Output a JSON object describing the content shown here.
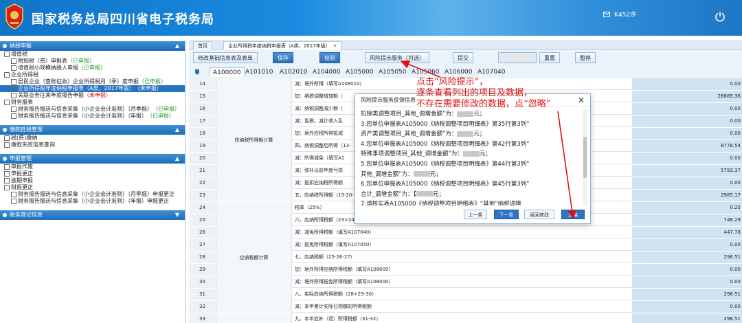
{
  "header": {
    "title": "国家税务总局四川省电子税务局",
    "user": "K452序"
  },
  "sidebar": {
    "sections": [
      {
        "title": "纳税申报",
        "items": [
          {
            "level": 1,
            "label": "增值税",
            "status": ""
          },
          {
            "level": 2,
            "label": "附加税（费）申报表",
            "status": "（已申报）",
            "status_color": "green"
          },
          {
            "level": 2,
            "label": "增值税小规模纳税人申报",
            "status": "（已申报）",
            "status_color": "green"
          },
          {
            "level": 1,
            "label": "企业所得税",
            "status": ""
          },
          {
            "level": 2,
            "label": "居民企业（查账征收）企业所得税月（季）度申报",
            "status": "（已申报）",
            "status_color": "green"
          },
          {
            "level": 2,
            "label": "企业所得税年度纳税申报表（A类，2017年版）",
            "status": "（未申报）",
            "status_color": "red",
            "selected": true
          },
          {
            "level": 2,
            "label": "关联业务往来年度报告申报",
            "status": "（未申报）",
            "status_color": "red"
          },
          {
            "level": 1,
            "label": "财务报表",
            "status": ""
          },
          {
            "level": 2,
            "label": "财务报告报送与信息采集（小企业会计准则）（月季报）",
            "status": "（已申报）",
            "status_color": "green"
          },
          {
            "level": 2,
            "label": "财务报告报送与信息采集（小企业会计准则）（年报）",
            "status": "（已申报）",
            "status_color": "green"
          }
        ]
      },
      {
        "title": "缴款抵税管理",
        "items": [
          {
            "level": 1,
            "label": "税(费)缴纳",
            "status": ""
          },
          {
            "level": 1,
            "label": "缴款失败信息查询",
            "status": ""
          }
        ]
      },
      {
        "title": "申报管理",
        "items": [
          {
            "level": 1,
            "label": "申报作废",
            "status": ""
          },
          {
            "level": 1,
            "label": "申报更正",
            "status": ""
          },
          {
            "level": 1,
            "label": "逾期申报",
            "status": ""
          },
          {
            "level": 1,
            "label": "财报更正",
            "status": ""
          },
          {
            "level": 2,
            "label": "财务报告报送与信息采集（小企业会计准则）（月季报）申报更正",
            "status": ""
          },
          {
            "level": 2,
            "label": "财务报告报送与信息采集（小企业会计准则）（年报）申报更正",
            "status": ""
          }
        ]
      },
      {
        "title": "税务登记信息",
        "items": []
      }
    ]
  },
  "tabs": [
    {
      "label": "首页",
      "closable": false
    },
    {
      "label": "企业所得税年度纳税申报表（A类，2017年版）",
      "closable": true
    }
  ],
  "toolbar": {
    "buttons": [
      "修改基础信息表及表单",
      "保存",
      "校验",
      "风险提示服务（可选）",
      "提交",
      "",
      "重置",
      "暂停"
    ]
  },
  "form_tabs": [
    "A100000",
    "A101010",
    "A102010",
    "A104000",
    "A105000",
    "A105050",
    "A105060",
    "A106000",
    "A107040"
  ],
  "grid": {
    "rows": [
      {
        "idx": "14",
        "desc": "减：境外所得（填写A108010）",
        "val": "0.00"
      },
      {
        "idx": "15",
        "desc": "加：纳税调整增加额（",
        "val": "26889.36"
      },
      {
        "idx": "16",
        "desc": "减：纳税调整减少额（",
        "val": "0.00"
      },
      {
        "idx": "17",
        "desc": "减：免税、减计收入及",
        "val": "0.00"
      },
      {
        "idx": "18",
        "desc": "加：境外应税所得抵减",
        "val": "0.00"
      },
      {
        "idx": "19",
        "desc": "四、纳税调整后所得（13-",
        "val": "8778.54"
      },
      {
        "idx": "20",
        "desc": "减：所得减免（填写A1",
        "val": "0.00"
      },
      {
        "idx": "21",
        "desc": "减：弥补以前年度亏损",
        "val": "5793.37"
      },
      {
        "idx": "22",
        "desc": "减：抵扣应纳税所得额",
        "val": "0.00"
      },
      {
        "idx": "23",
        "desc": "五、应纳税所得额（19-20-",
        "val": "2985.17"
      },
      {
        "idx": "24",
        "desc": "税率（25%）",
        "val": "0.25"
      },
      {
        "idx": "25",
        "desc": "六、应纳所得税额（23×24",
        "val": "746.29"
      },
      {
        "idx": "26",
        "desc": "减：减免所得税额（填写A107040）",
        "val": "447.78"
      },
      {
        "idx": "27",
        "desc": "减：抵免所得税额（填写A107050）",
        "val": "0.00"
      },
      {
        "idx": "28",
        "desc": "七、应纳税额（25-26-27）",
        "val": "298.51"
      },
      {
        "idx": "29",
        "desc": "加：境外所得应纳所得税额（填写A108000）",
        "val": "0.00"
      },
      {
        "idx": "30",
        "desc": "减：境外所得抵免所得税额（填写A108000）",
        "val": "0.00"
      },
      {
        "idx": "31",
        "desc": "八、实际应纳所得税额（28+29-30）",
        "val": "298.51"
      },
      {
        "idx": "32",
        "desc": "减：本年累计实际已预缴的所得税额",
        "val": "0.00"
      },
      {
        "idx": "33",
        "desc": "九、本年应补（退）所得税额（31-32）",
        "val": "298.51"
      }
    ],
    "category_1": "应纳税所得额计算",
    "category_2": "应纳税额计算"
  },
  "dialog": {
    "title": "风险提示服务反馈信息",
    "lines": [
      "扣除类调整项目_其他_调增金额”为：",
      "3.您单位申报表A105000《纳税调整项目明细表》第35行第3列“",
      "资产类调整项目_其他_调增金额”为：",
      "4.您单位申报表A105000《纳税调整项目明细表》第42行第3列“",
      "特殊事项调整项目_其他_调增金额”为：",
      "5.您单位申报表A105000《纳税调整项目明细表》第44行第3列“",
      "其他_调增金额”为：",
      "6.您单位申报表A105000《纳税调整项目明细表》第45行第3列“",
      "合计_调增金额”为：【",
      "7.请核实表A105000《纳税调整项目明细表》“其他”纳税调增"
    ],
    "unit_suffix": "元；",
    "buttons": [
      "上一条",
      "下一条",
      "返回修改",
      "忽略"
    ]
  },
  "annotation": {
    "line1": "点击“风险提示”，",
    "line2": "逐条查看列出的项目及数据，",
    "line3": "不存在需要修改的数据，点“忽略”",
    "color": "#e01010"
  }
}
